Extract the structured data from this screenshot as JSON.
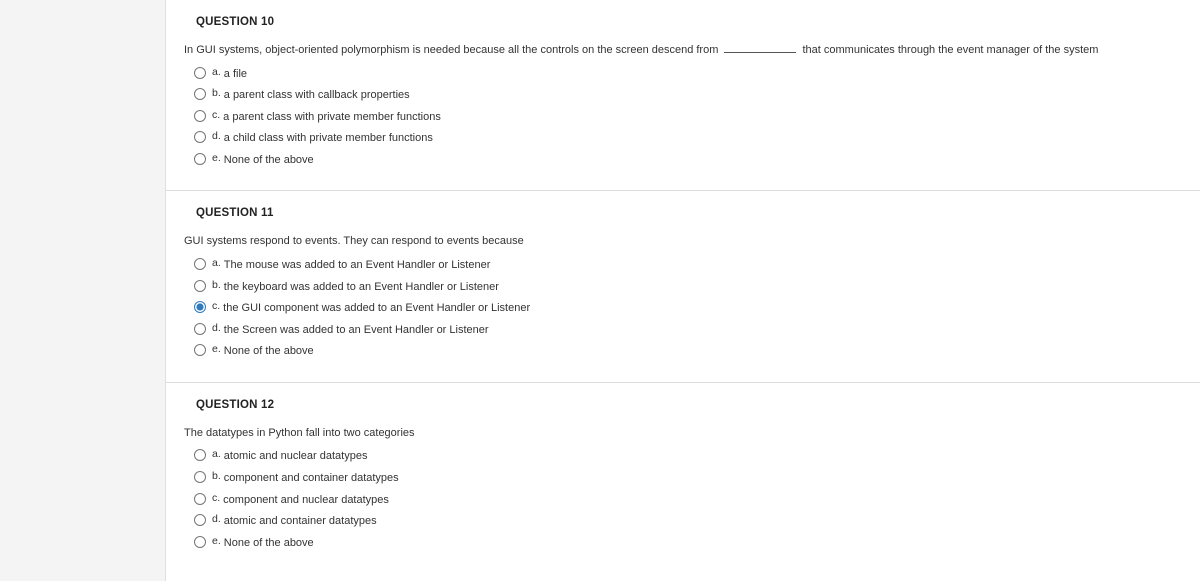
{
  "questions": [
    {
      "title": "QUESTION 10",
      "prompt_before": "In GUI systems, object-oriented polymorphism is needed because all the controls on the screen descend from ",
      "prompt_after": " that communicates through the event manager of the system",
      "has_blank": true,
      "selected": null,
      "options": [
        {
          "letter": "a.",
          "text": "a file"
        },
        {
          "letter": "b.",
          "text": "a parent class with callback properties"
        },
        {
          "letter": "c.",
          "text": "a parent class with private member functions"
        },
        {
          "letter": "d.",
          "text": "a child class with private member functions"
        },
        {
          "letter": "e.",
          "text": "None of the above"
        }
      ]
    },
    {
      "title": "QUESTION 11",
      "prompt_before": "GUI systems respond to events. They can respond to events because",
      "prompt_after": "",
      "has_blank": false,
      "selected": 2,
      "options": [
        {
          "letter": "a.",
          "text": "The mouse was added to an Event Handler or Listener"
        },
        {
          "letter": "b.",
          "text": "the keyboard was added to an Event Handler or Listener"
        },
        {
          "letter": "c.",
          "text": "the GUI component was added to an Event Handler or Listener"
        },
        {
          "letter": "d.",
          "text": "the Screen was added to an Event Handler or Listener"
        },
        {
          "letter": "e.",
          "text": "None of the above"
        }
      ]
    },
    {
      "title": "QUESTION 12",
      "prompt_before": "The datatypes in Python fall into two categories",
      "prompt_after": "",
      "has_blank": false,
      "selected": null,
      "options": [
        {
          "letter": "a.",
          "text": "atomic and nuclear datatypes"
        },
        {
          "letter": "b.",
          "text": "component and container datatypes"
        },
        {
          "letter": "c.",
          "text": "component and nuclear datatypes"
        },
        {
          "letter": "d.",
          "text": "atomic and container datatypes"
        },
        {
          "letter": "e.",
          "text": "None of the above"
        }
      ]
    }
  ]
}
